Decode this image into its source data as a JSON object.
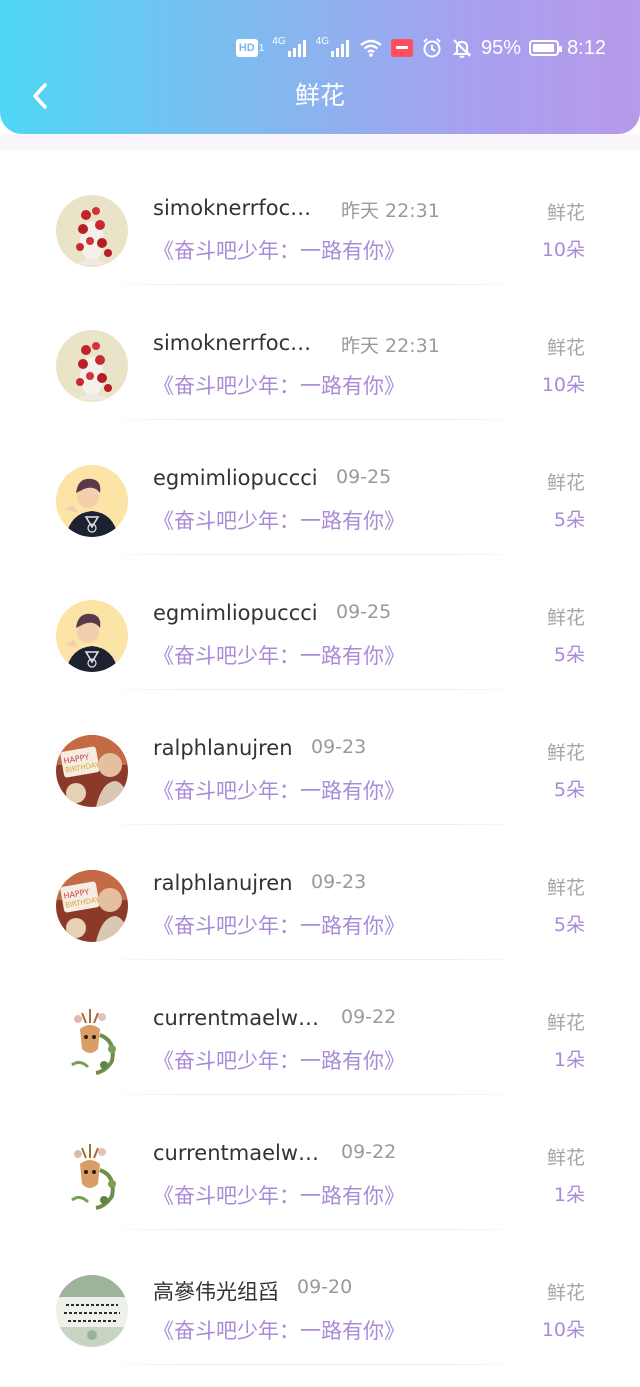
{
  "status_bar": {
    "hd": "HD",
    "hd_sub": "1",
    "signal1_tag": "4G",
    "signal2_tag": "4G",
    "battery_percent": "95%",
    "battery_level": 0.95,
    "time": "8:12",
    "icons": [
      "hd-icon",
      "signal-icon",
      "signal-icon",
      "wifi-icon",
      "huawei-app-icon",
      "alarm-icon",
      "mute-icon",
      "battery-icon"
    ]
  },
  "header": {
    "title": "鲜花",
    "back_icon": "chevron-left-icon",
    "gradient": [
      "#4fd6f6",
      "#b79ae9"
    ]
  },
  "colors": {
    "accent": "#a98bd8",
    "name": "#333333",
    "muted": "#9a9a9a"
  },
  "rows": [
    {
      "name": "simoknerrfochad",
      "time": "昨天 22:31",
      "show": "《奋斗吧少年：一路有你》",
      "type": "鲜花",
      "count": "10朵",
      "avatar": "roses-avatar"
    },
    {
      "name": "simoknerrfochad",
      "time": "昨天 22:31",
      "show": "《奋斗吧少年：一路有你》",
      "type": "鲜花",
      "count": "10朵",
      "avatar": "roses-avatar"
    },
    {
      "name": "egmimliopuccci",
      "time": "09-25",
      "show": "《奋斗吧少年：一路有你》",
      "type": "鲜花",
      "count": "5朵",
      "avatar": "boy-avatar"
    },
    {
      "name": "egmimliopuccci",
      "time": "09-25",
      "show": "《奋斗吧少年：一路有你》",
      "type": "鲜花",
      "count": "5朵",
      "avatar": "boy-avatar"
    },
    {
      "name": "ralphlanujren",
      "time": "09-23",
      "show": "《奋斗吧少年：一路有你》",
      "type": "鲜花",
      "count": "5朵",
      "avatar": "birthday-avatar"
    },
    {
      "name": "ralphlanujren",
      "time": "09-23",
      "show": "《奋斗吧少年：一路有你》",
      "type": "鲜花",
      "count": "5朵",
      "avatar": "birthday-avatar"
    },
    {
      "name": "currentmaelwli...",
      "time": "09-22",
      "show": "《奋斗吧少年：一路有你》",
      "type": "鲜花",
      "count": "1朵",
      "avatar": "deer-avatar"
    },
    {
      "name": "currentmaelwli...",
      "time": "09-22",
      "show": "《奋斗吧少年：一路有你》",
      "type": "鲜花",
      "count": "1朵",
      "avatar": "deer-avatar"
    },
    {
      "name": "高嵾伟光组舀",
      "time": "09-20",
      "show": "《奋斗吧少年：一路有你》",
      "type": "鲜花",
      "count": "10朵",
      "avatar": "calligraphy-avatar"
    }
  ]
}
